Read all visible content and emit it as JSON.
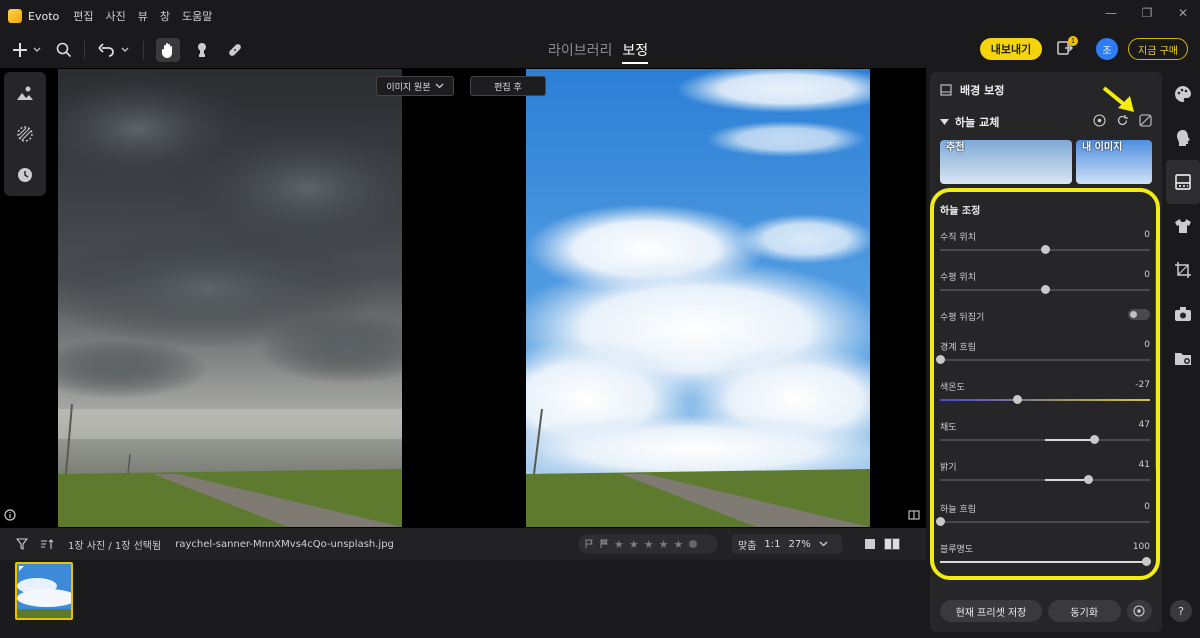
{
  "window": {
    "app_name": "Evoto",
    "menu": [
      "편집",
      "사진",
      "뷰",
      "창",
      "도움말"
    ],
    "controls": [
      "minimize-icon",
      "restore-icon",
      "close-icon"
    ]
  },
  "toolbar": {
    "tabs": [
      {
        "label": "라이브러리",
        "active": false
      },
      {
        "label": "보정",
        "active": true
      }
    ],
    "export_label": "내보내기",
    "notification_count": "1",
    "avatar_initial": "조",
    "buy_label": "지금 구매"
  },
  "canvas": {
    "compare_label": "이미지 원본",
    "after_label": "편집 후"
  },
  "bottombar": {
    "count_text": "1장 사진 / 1장 선택됨",
    "filename": "raychel-sanner-MnnXMvs4cQo-unsplash.jpg",
    "stars": [
      "★",
      "★",
      "★",
      "★",
      "★"
    ],
    "zoom_fit": "맞춤",
    "zoom_one": "1:1",
    "zoom_pct": "27%"
  },
  "panel": {
    "title": "배경 보정",
    "section": "하늘 교체",
    "sky_thumbs": [
      "추천",
      "내 이미지"
    ],
    "adjust_title": "하늘 조정",
    "sliders": [
      {
        "label": "수직 위치",
        "value": "0",
        "pos": 0.5,
        "type": "center"
      },
      {
        "label": "수평 위치",
        "value": "0",
        "pos": 0.5,
        "type": "center"
      },
      {
        "label": "수평 뒤집기",
        "value": "",
        "pos": 0,
        "type": "toggle"
      },
      {
        "label": "경계 흐림",
        "value": "0",
        "pos": 0.0,
        "type": "left"
      },
      {
        "label": "색온도",
        "value": "-27",
        "pos": 0.365,
        "type": "temp"
      },
      {
        "label": "채도",
        "value": "47",
        "pos": 0.735,
        "type": "center"
      },
      {
        "label": "밝기",
        "value": "41",
        "pos": 0.705,
        "type": "center"
      },
      {
        "label": "하늘 흐림",
        "value": "0",
        "pos": 0.0,
        "type": "left"
      },
      {
        "label": "블루명도",
        "value": "100",
        "pos": 0.98,
        "type": "left"
      }
    ],
    "save_preset_label": "현재 프리셋 저장",
    "sync_label": "동기화"
  },
  "help_label": "?"
}
